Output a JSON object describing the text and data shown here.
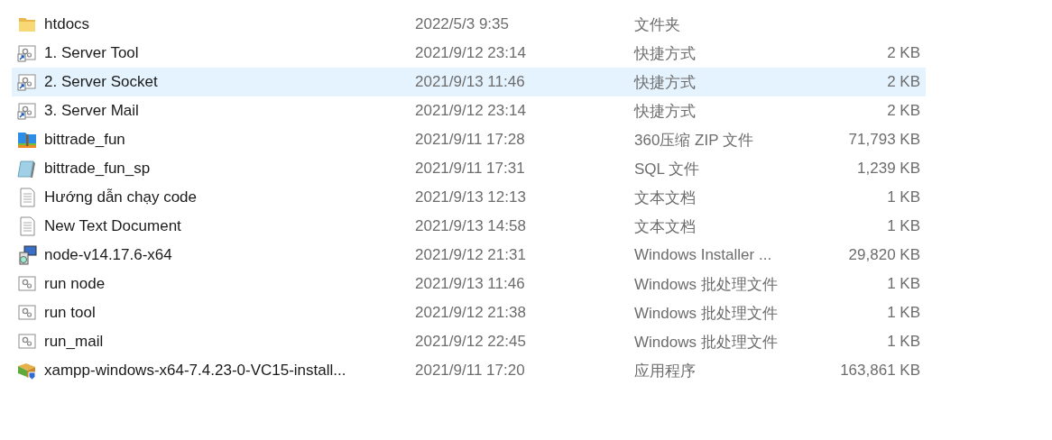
{
  "files": [
    {
      "kind": "folder",
      "name": "htdocs",
      "modified": "2022/5/3 9:35",
      "type": "文件夹",
      "selected": false
    },
    {
      "kind": "shortcut",
      "name": "1. Server Tool",
      "modified": "2021/9/12 23:14",
      "type": "快捷方式",
      "size": "2 KB",
      "selected": false
    },
    {
      "kind": "shortcut",
      "name": "2. Server Socket",
      "modified": "2021/9/13 11:46",
      "type": "快捷方式",
      "size": "2 KB",
      "selected": true
    },
    {
      "kind": "shortcut",
      "name": "3. Server Mail",
      "modified": "2021/9/12 23:14",
      "type": "快捷方式",
      "size": "2 KB",
      "selected": false
    },
    {
      "kind": "archive",
      "name": "bittrade_fun",
      "modified": "2021/9/11 17:28",
      "type": "360压缩 ZIP 文件",
      "size": "71,793 KB",
      "selected": false
    },
    {
      "kind": "sql",
      "name": "bittrade_fun_sp",
      "modified": "2021/9/11 17:31",
      "type": "SQL 文件",
      "size": "1,239 KB",
      "selected": false
    },
    {
      "kind": "text",
      "name": "Hướng dẫn chạy code",
      "modified": "2021/9/13 12:13",
      "type": "文本文档",
      "size": "1 KB",
      "selected": false
    },
    {
      "kind": "text",
      "name": "New Text Document",
      "modified": "2021/9/13 14:58",
      "type": "文本文档",
      "size": "1 KB",
      "selected": false
    },
    {
      "kind": "installer",
      "name": "node-v14.17.6-x64",
      "modified": "2021/9/12 21:31",
      "type": "Windows Installer ...",
      "size": "29,820 KB",
      "selected": false
    },
    {
      "kind": "batch",
      "name": "run node",
      "modified": "2021/9/13 11:46",
      "type": "Windows 批处理文件",
      "size": "1 KB",
      "selected": false
    },
    {
      "kind": "batch",
      "name": "run tool",
      "modified": "2021/9/12 21:38",
      "type": "Windows 批处理文件",
      "size": "1 KB",
      "selected": false
    },
    {
      "kind": "batch",
      "name": "run_mail",
      "modified": "2021/9/12 22:45",
      "type": "Windows 批处理文件",
      "size": "1 KB",
      "selected": false
    },
    {
      "kind": "app",
      "name": "xampp-windows-x64-7.4.23-0-VC15-install...",
      "modified": "2021/9/11 17:20",
      "type": "应用程序",
      "size": "163,861 KB",
      "selected": false
    }
  ]
}
